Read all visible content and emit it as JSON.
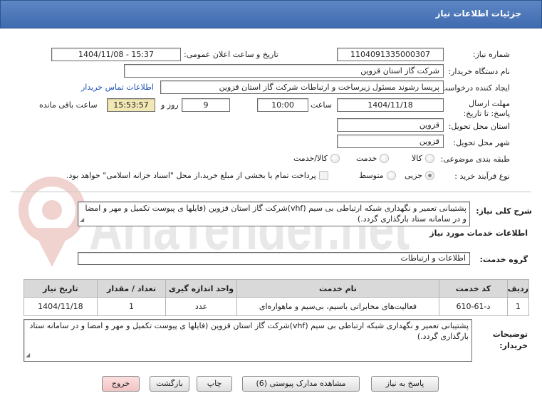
{
  "header": {
    "title": "جزئیات اطلاعات نیاز"
  },
  "form": {
    "need_number_label": "شماره نیاز:",
    "need_number": "1104091335000307",
    "announce_label": "تاریخ و ساعت اعلان عمومی:",
    "announce_value": "1404/11/08 - 15:37",
    "buyer_org_label": "نام دستگاه خریدار:",
    "buyer_org": "شرکت گاز استان قزوین",
    "creator_label": "ایجاد کننده درخواست:",
    "creator": "پریسا رشوند مسئول زیرساخت و ارتباطات شرکت گاز استان قزوین",
    "contact_link": "اطلاعات تماس خریدار",
    "deadline_label": "مهلت ارسال پاسخ: تا تاریخ:",
    "deadline_date": "1404/11/18",
    "time_label": "ساعت",
    "deadline_time": "10:00",
    "days_value": "9",
    "days_label": "روز و",
    "remaining_time": "15:53:57",
    "remaining_label": "ساعت باقی مانده",
    "province_label": "استان محل تحویل:",
    "province": "قزوین",
    "city_label": "شهر محل تحویل:",
    "city": "قزوین",
    "category_label": "طبقه بندی موضوعی:",
    "category_options": [
      "کالا",
      "خدمت",
      "کالا/خدمت"
    ],
    "process_label": "نوع فرآیند خرید :",
    "process_options": [
      "جزیی",
      "متوسط"
    ],
    "payment_note": "پرداخت تمام یا بخشی از مبلغ خرید،از محل \"اسناد خزانه اسلامی\" خواهد بود."
  },
  "summary": {
    "label": "شرح کلی نیاز:",
    "text": "پشتیبانی تعمیر و نگهداری شبکه ارتباطی بی سیم (vhf)شرکت گاز استان قزوین (فایلها ی پیوست تکمیل و مهر و امضا و در سامانه ستاد بارگذاری گردد.)"
  },
  "services": {
    "section_title": "اطلاعات خدمات مورد نیاز",
    "group_label": "گروه خدمت:",
    "group_value": "اطلاعات و ارتباطات",
    "columns": [
      "ردیف",
      "کد خدمت",
      "نام خدمت",
      "واحد اندازه گیری",
      "تعداد / مقدار",
      "تاریخ نیاز"
    ],
    "rows": [
      [
        "1",
        "د-61-610",
        "فعالیت‌های مخابراتی باسیم، بی‌سیم و ماهواره‌ای",
        "عدد",
        "1",
        "1404/11/18"
      ]
    ]
  },
  "buyer_notes": {
    "label": "توضیحات خریدار:",
    "text": "پشتیبانی تعمیر و نگهداری شبکه ارتباطی بی سیم (vhf)شرکت گاز استان قزوین (فایلها ی پیوست تکمیل و مهر و امضا و در سامانه ستاد بارگذاری گردد.)"
  },
  "buttons": {
    "reply": "پاسخ به نیاز",
    "attachments": "مشاهده مدارک پیوستی (6)",
    "print": "چاپ",
    "back": "بازگشت",
    "exit": "خروج"
  },
  "watermark": "AriaTender.net",
  "colors": {
    "header": "#4a76b8",
    "remaining_bg": "#f2e8b4",
    "link": "#1a4fb8",
    "exit_bg": "#f2c3c3"
  }
}
